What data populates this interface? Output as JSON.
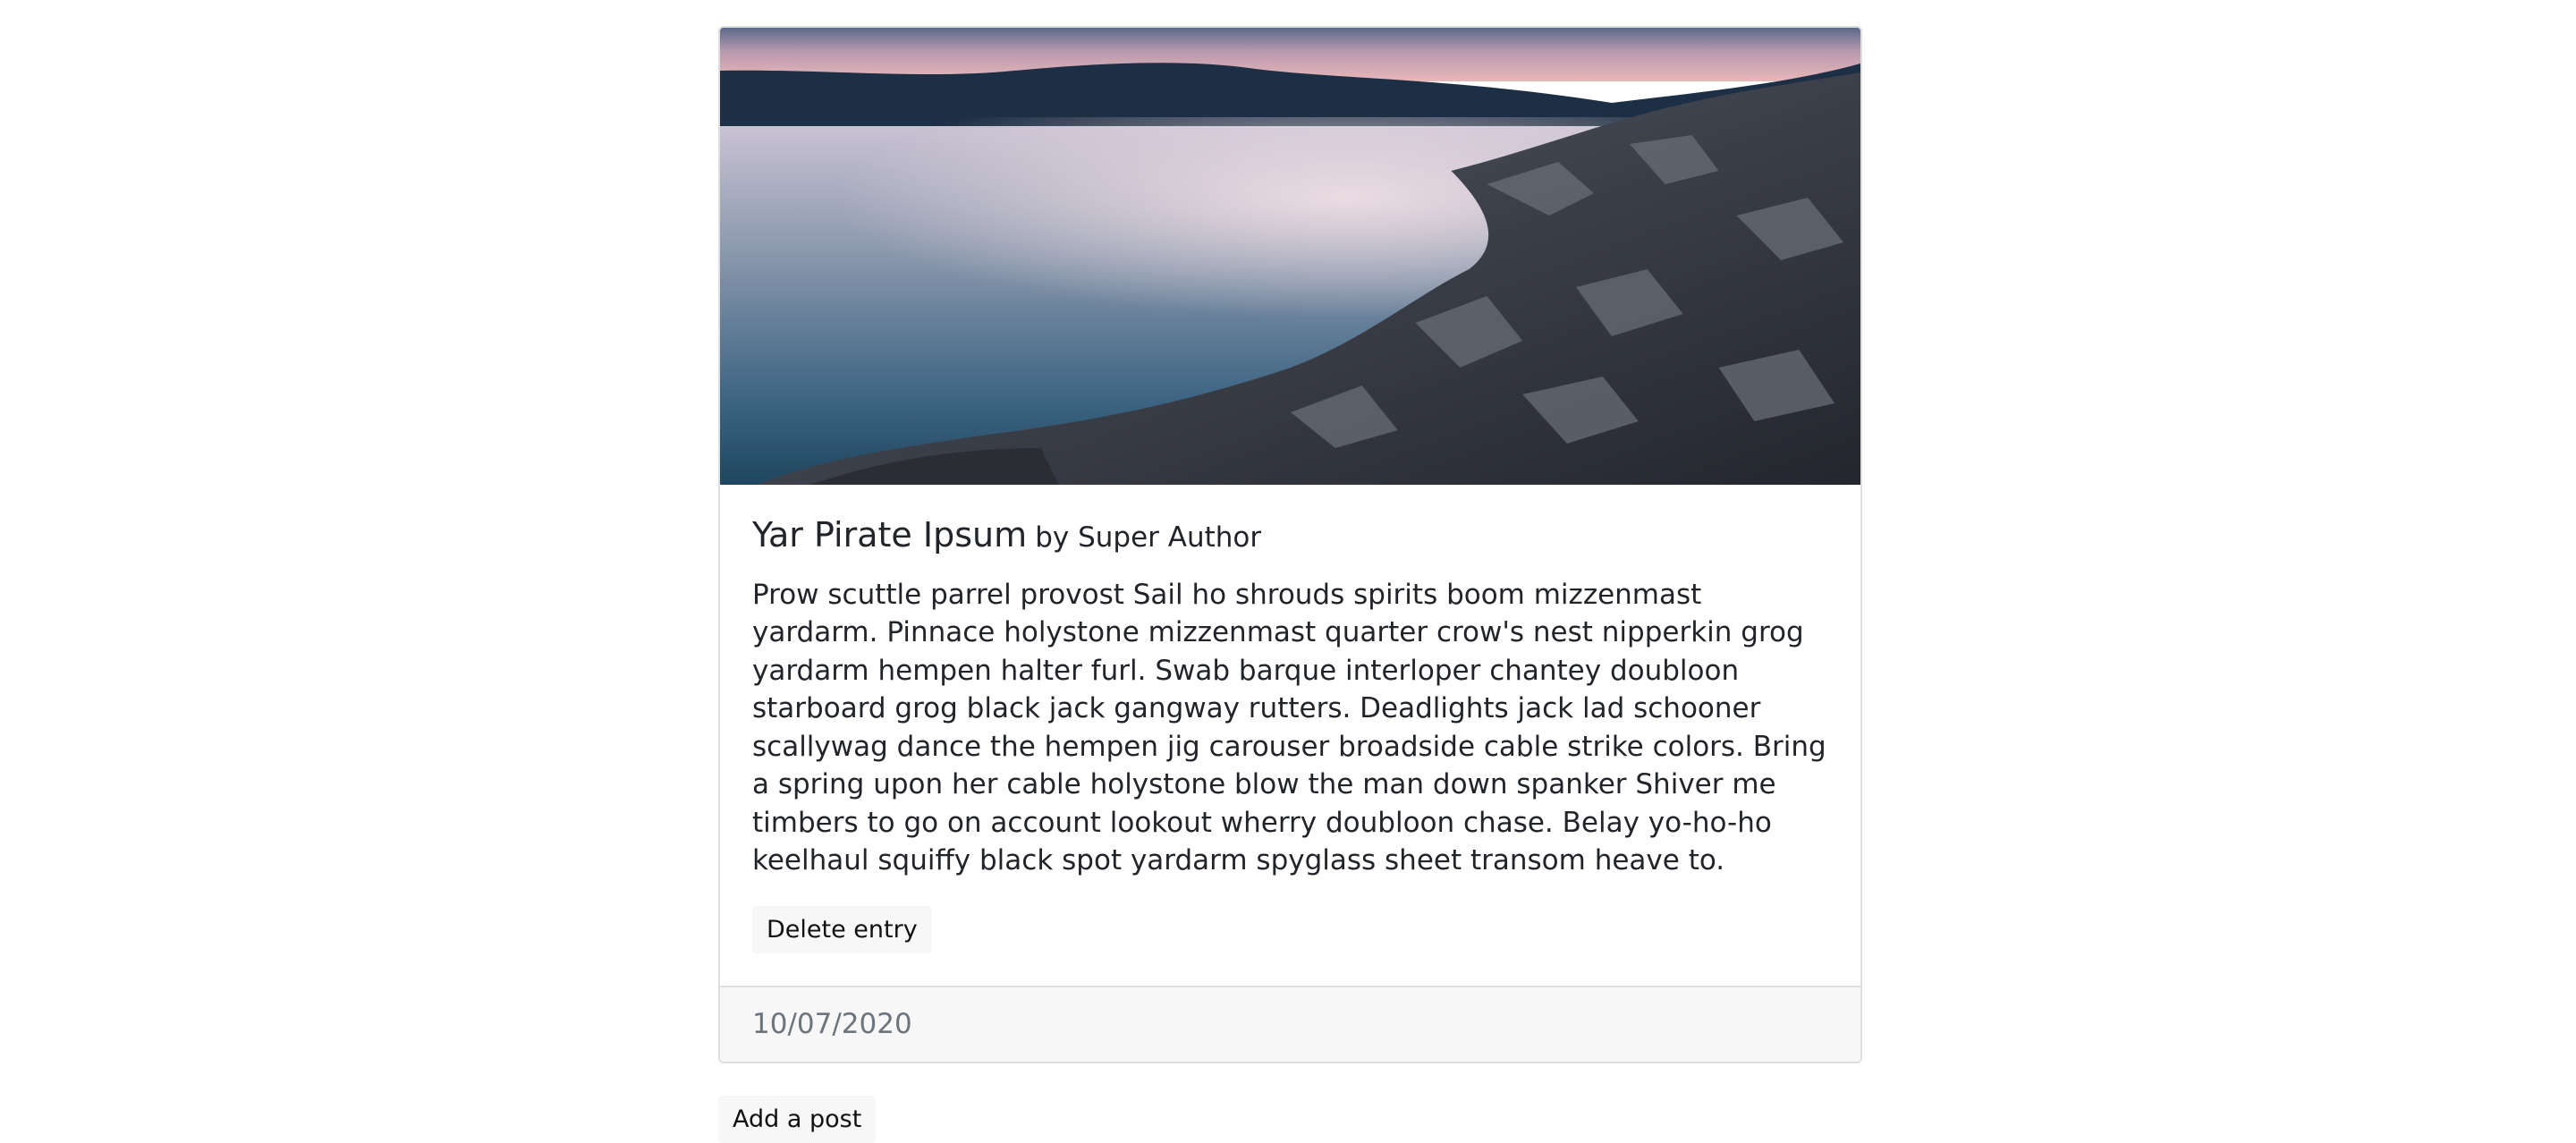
{
  "entry": {
    "title": "Yar Pirate Ipsum",
    "author": "by Super Author",
    "body": "Prow scuttle parrel provost Sail ho shrouds spirits boom mizzenmast yardarm. Pinnace holystone mizzenmast quarter crow's nest nipperkin grog yardarm hempen halter furl. Swab barque interloper chantey doubloon starboard grog black jack gangway rutters. Deadlights jack lad schooner scallywag dance the hempen jig carouser broadside cable strike colors. Bring a spring upon her cable holystone blow the man down spanker Shiver me timbers to go on account lookout wherry doubloon chase. Belay yo-ho-ho keelhaul squiffy black spot yardarm spyglass sheet transom heave to.",
    "delete_label": "Delete entry",
    "date": "10/07/2020",
    "image_icon": "landscape-photo"
  },
  "actions": {
    "add_post_label": "Add a post"
  },
  "colors": {
    "card_border": "#dfdfdf",
    "footer_bg": "#f7f7f7",
    "button_bg": "#f7f7f7",
    "muted_text": "#6c757d"
  }
}
